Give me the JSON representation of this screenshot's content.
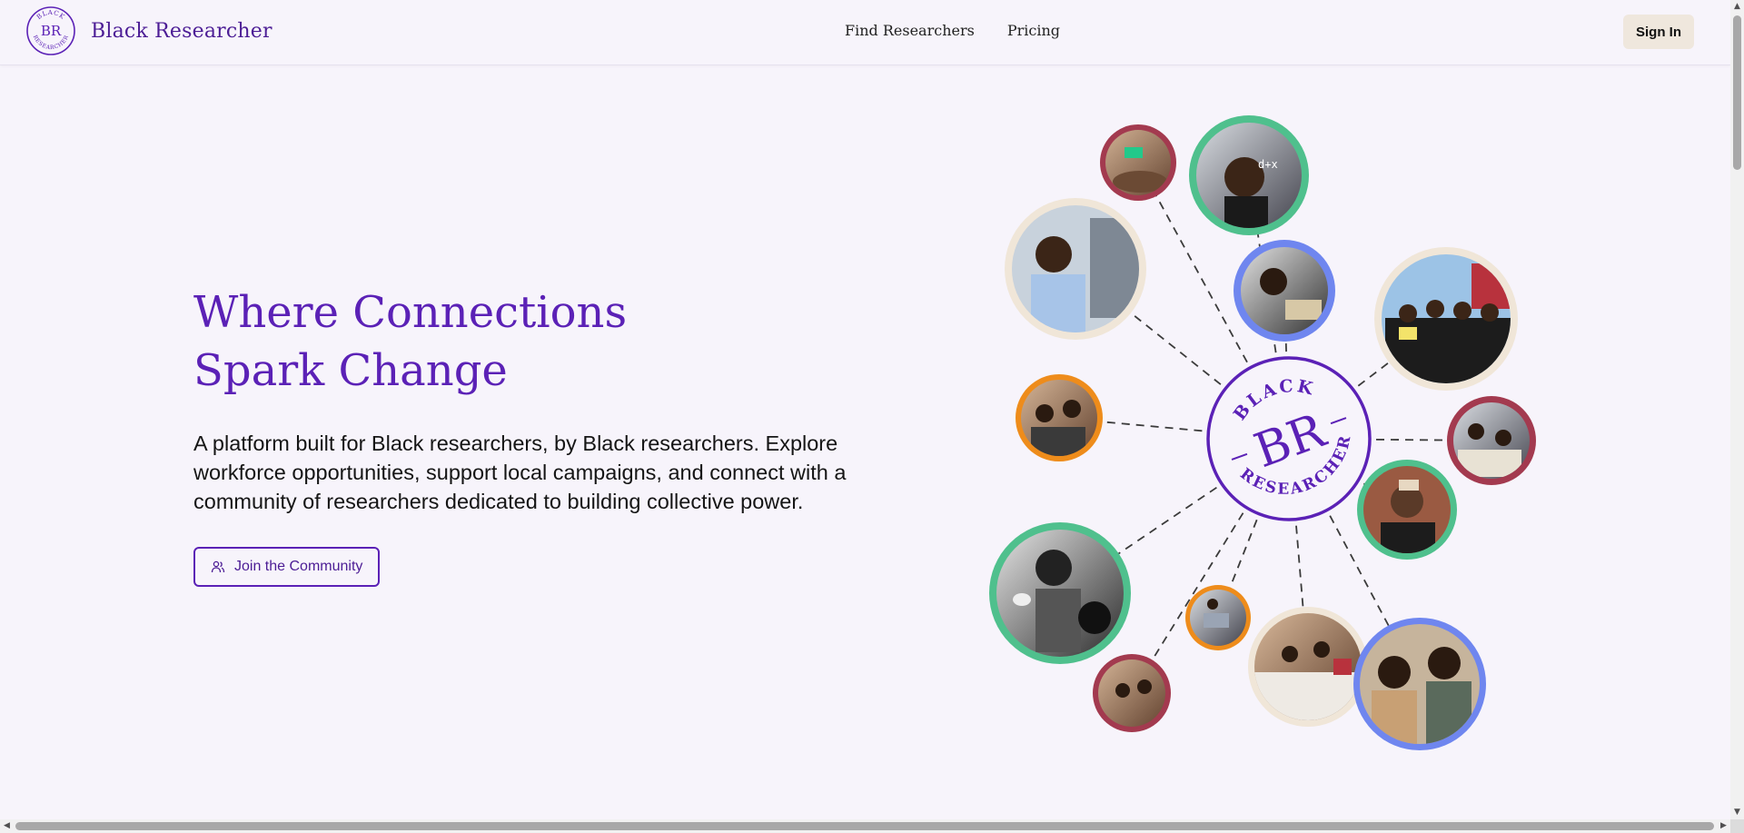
{
  "header": {
    "brand_name": "Black Researcher",
    "logo": {
      "top_text": "BLACK",
      "initials": "BR",
      "bottom_text": "RESEARCHER"
    },
    "nav": [
      {
        "label": "Find Researchers"
      },
      {
        "label": "Pricing"
      }
    ],
    "sign_in_label": "Sign In"
  },
  "hero": {
    "title_line1": "Where Connections",
    "title_line2": "Spark Change",
    "description": "A platform built for Black researchers, by Black researchers. Explore workforce opportunities, support local campaigns, and connect with a community of researchers dedicated to building collective power.",
    "cta_label": "Join the Community",
    "cta_icon": "users-icon"
  },
  "graphic": {
    "center_logo": {
      "top_text": "BLACK",
      "initials": "BR",
      "bottom_text": "RESEARCHER"
    },
    "ring_colors": {
      "green": "#4fc08d",
      "maroon": "#a33a4f",
      "blue": "#6f86ef",
      "cream": "#f0e6d8",
      "orange": "#ee8c1b"
    },
    "photos": [
      "photo-meeting-room",
      "photo-woman-writing-formulas",
      "photo-man-at-whiteboard",
      "photo-man-writing-at-desk",
      "photo-collective-group",
      "photo-three-women-talking",
      "photo-classroom-group",
      "photo-woman-portrait",
      "photo-women-at-event",
      "photo-laptop-meeting",
      "photo-workshop-room",
      "photo-two-students-reading",
      "photo-small-gathering"
    ]
  },
  "brand_color": "#5b21b6"
}
